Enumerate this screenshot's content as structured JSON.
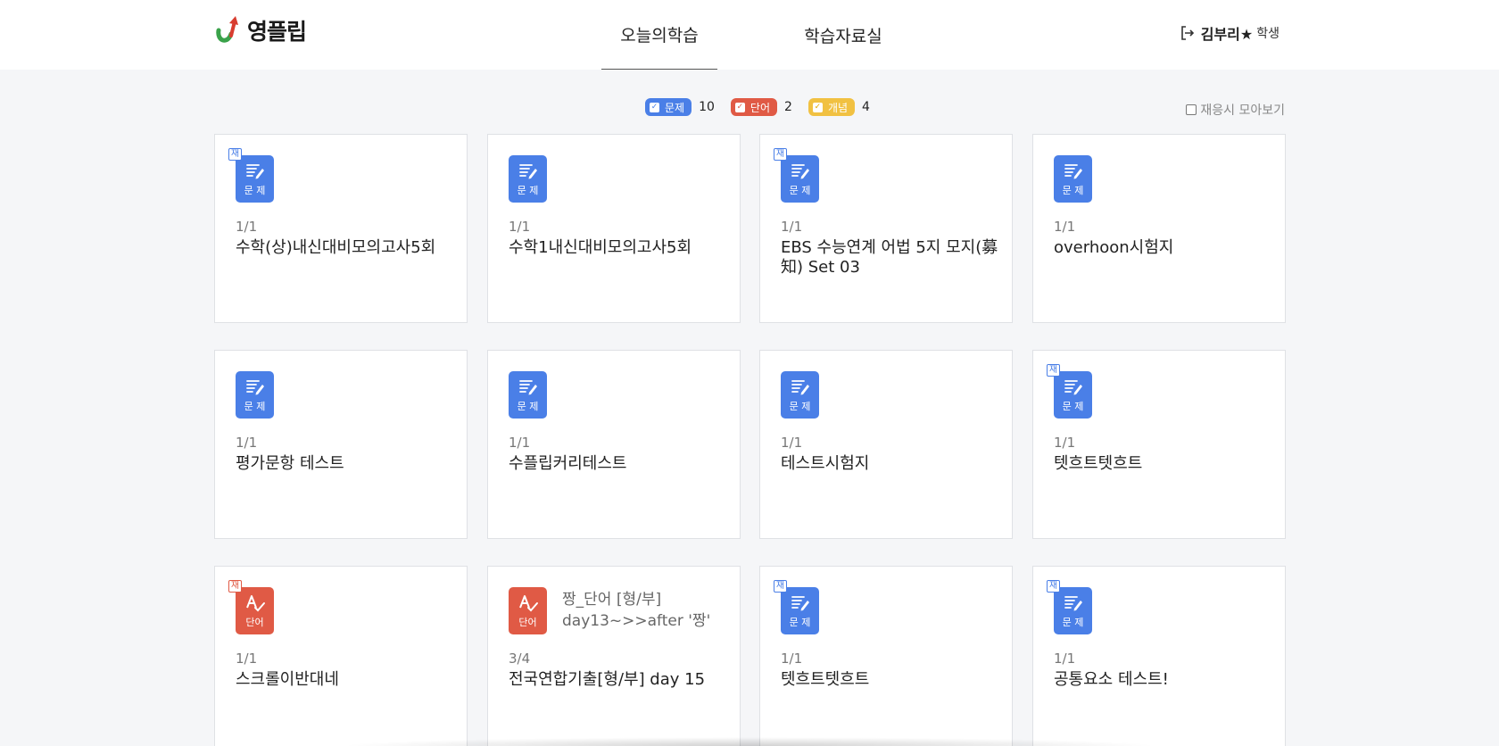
{
  "header": {
    "logo_text": "영플립",
    "tabs": [
      {
        "label": "오늘의학습",
        "active": true
      },
      {
        "label": "학습자료실",
        "active": false
      }
    ],
    "user_name": "김부리★",
    "user_role": "학생",
    "logout_icon": "logout-icon"
  },
  "filters": [
    {
      "label": "문제",
      "count": "10",
      "color": "#4a7fe7",
      "checked": true
    },
    {
      "label": "단어",
      "count": "2",
      "color": "#e05a45",
      "checked": true
    },
    {
      "label": "개념",
      "count": "4",
      "color": "#f1c142",
      "checked": true
    }
  ],
  "collect_label": "재응시 모아보기",
  "cards": [
    {
      "type": "problem",
      "type_label": "문 제",
      "rebadge": "재",
      "progress": "1/1",
      "title": "수학(상)내신대비모의고사5회",
      "subtitle": ""
    },
    {
      "type": "problem",
      "type_label": "문 제",
      "rebadge": "",
      "progress": "1/1",
      "title": "수학1내신대비모의고사5회",
      "subtitle": ""
    },
    {
      "type": "problem",
      "type_label": "문 제",
      "rebadge": "재",
      "progress": "1/1",
      "title": "EBS 수능연계 어법 5지 모지(募知) Set 03",
      "subtitle": ""
    },
    {
      "type": "problem",
      "type_label": "문 제",
      "rebadge": "",
      "progress": "1/1",
      "title": "overhoon시험지",
      "subtitle": ""
    },
    {
      "type": "problem",
      "type_label": "문 제",
      "rebadge": "",
      "progress": "1/1",
      "title": "평가문항 테스트",
      "subtitle": ""
    },
    {
      "type": "problem",
      "type_label": "문 제",
      "rebadge": "",
      "progress": "1/1",
      "title": "수플립커리테스트",
      "subtitle": ""
    },
    {
      "type": "problem",
      "type_label": "문 제",
      "rebadge": "",
      "progress": "1/1",
      "title": "테스트시험지",
      "subtitle": ""
    },
    {
      "type": "problem",
      "type_label": "문 제",
      "rebadge": "재",
      "progress": "1/1",
      "title": "텟흐트텟흐트",
      "subtitle": ""
    },
    {
      "type": "word",
      "type_label": "단어",
      "rebadge": "재",
      "progress": "1/1",
      "title": "스크롤이반대네",
      "subtitle": ""
    },
    {
      "type": "word",
      "type_label": "단어",
      "rebadge": "",
      "progress": "3/4",
      "title": "전국연합기출[형/부] day 15",
      "subtitle": "짱_단어 [형/부] day13~>>after '짱'"
    },
    {
      "type": "problem",
      "type_label": "문 제",
      "rebadge": "재",
      "progress": "1/1",
      "title": "텟흐트텟흐트",
      "subtitle": ""
    },
    {
      "type": "problem",
      "type_label": "문 제",
      "rebadge": "재",
      "progress": "1/1",
      "title": "공통요소 테스트!",
      "subtitle": ""
    }
  ]
}
